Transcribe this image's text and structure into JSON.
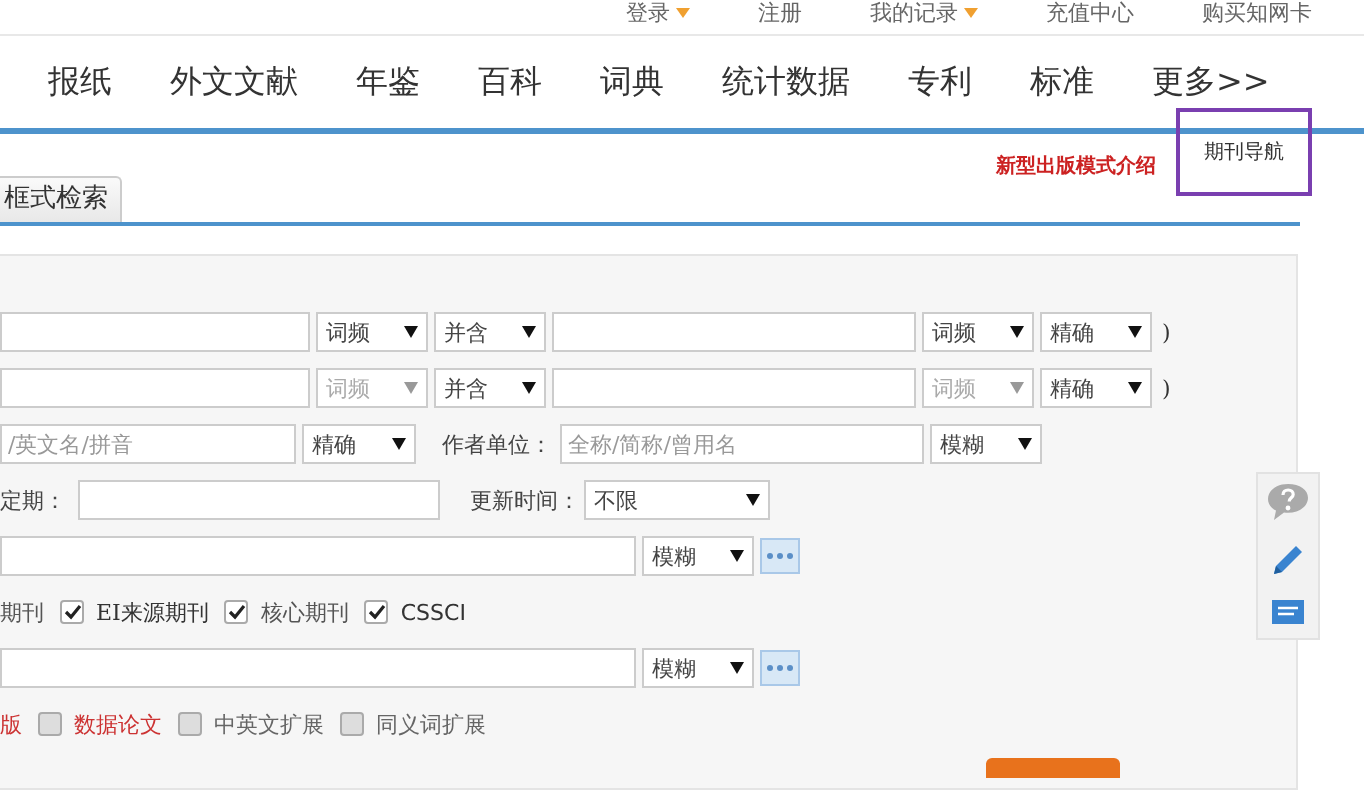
{
  "top_links": [
    {
      "label": "登录",
      "has_menu": true
    },
    {
      "label": "注册",
      "has_menu": false
    },
    {
      "label": "我的记录",
      "has_menu": true
    },
    {
      "label": "充值中心",
      "has_menu": false
    },
    {
      "label": "购买知网卡",
      "has_menu": false
    }
  ],
  "nav": [
    "报纸",
    "外文文献",
    "年鉴",
    "百科",
    "词典",
    "统计数据",
    "专利",
    "标准",
    "更多>>"
  ],
  "sub_links": {
    "intro": "新型出版模式介绍",
    "journal_nav": "期刊导航"
  },
  "tabs": [
    {
      "label": "框式检索",
      "selected": false
    }
  ],
  "form_rows": [
    {
      "kind": "term",
      "freq_1": {
        "value": "词频",
        "disabled": false
      },
      "relation": "并含",
      "freq_2": {
        "value": "词频",
        "disabled": false
      },
      "match": "精确",
      "close": ")"
    },
    {
      "kind": "term",
      "freq_1": {
        "value": "词频",
        "disabled": true
      },
      "relation": "并含",
      "freq_2": {
        "value": "词频",
        "disabled": true
      },
      "match": "精确",
      "close": ")"
    },
    {
      "kind": "author",
      "placeholder": "/英文名/拼音",
      "match": "精确",
      "unit_label": "作者单位：",
      "unit_placeholder": "全称/简称/曾用名",
      "unit_match": "模糊"
    },
    {
      "kind": "period",
      "label": "定期：",
      "update_label": "更新时间：",
      "update_value": "不限"
    },
    {
      "kind": "source",
      "match": "模糊"
    },
    {
      "kind": "checks",
      "items": [
        {
          "label": "期刊",
          "color": "#555555"
        },
        {
          "label": "EI来源期刊",
          "checked": true,
          "color": "#333333"
        },
        {
          "label": "核心期刊",
          "checked": true,
          "color": "#555555"
        },
        {
          "label": "CSSCI",
          "checked": true,
          "color": "#333333"
        }
      ]
    },
    {
      "kind": "source",
      "match": "模糊"
    },
    {
      "kind": "checks",
      "items": [
        {
          "label": "版",
          "color": "#cc3333"
        },
        {
          "label": "数据论文",
          "checked": false,
          "color": "#cc3333"
        },
        {
          "label": "中英文扩展",
          "checked": false,
          "color": "#666666"
        },
        {
          "label": "同义词扩展",
          "checked": false,
          "color": "#666666"
        }
      ]
    }
  ]
}
